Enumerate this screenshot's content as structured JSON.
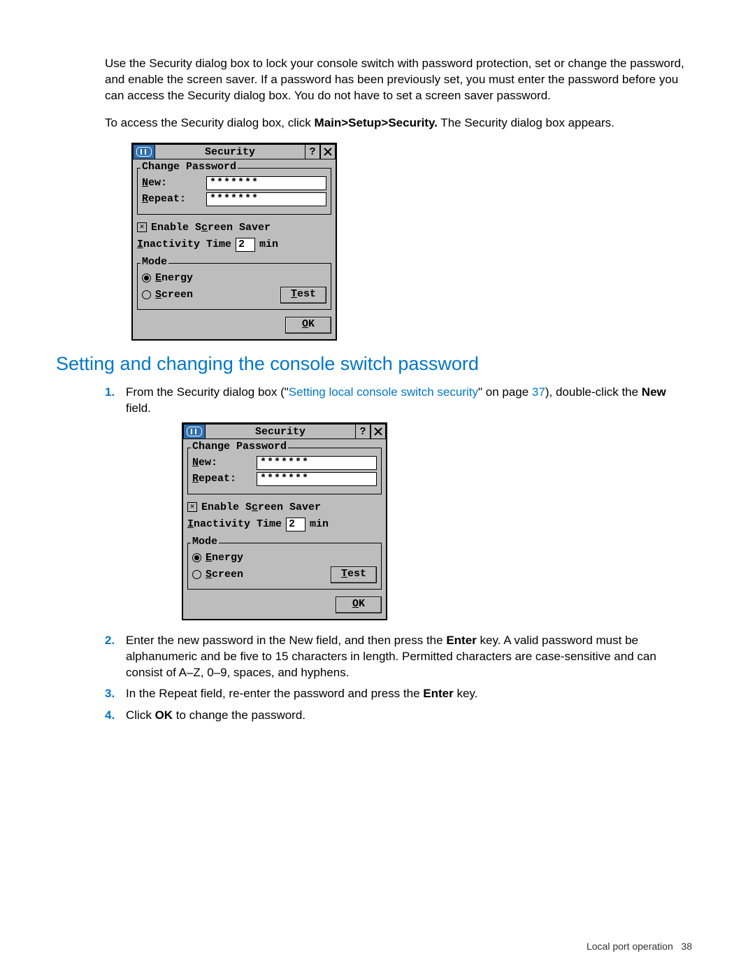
{
  "intro": {
    "p1": "Use the Security dialog box to lock your console switch with password protection, set or change the password, and enable the screen saver. If a password has been previously set, you must enter the password before you can access the Security dialog box. You do not have to set a screen saver password.",
    "p2_pre": "To access the Security dialog box, click ",
    "p2_bold": "Main>Setup>Security.",
    "p2_post": " The Security dialog box appears."
  },
  "heading": "Setting and changing the console switch password",
  "steps": {
    "s1_pre": "From the Security dialog box (\"",
    "s1_link": "Setting local console switch security",
    "s1_mid": "\" on page ",
    "s1_page": "37",
    "s1_post": "), double-click the ",
    "s1_bold": "New",
    "s1_end": " field.",
    "s2_pre": "Enter the new password in the New field, and then press the ",
    "s2_bold": "Enter",
    "s2_post": " key. A valid password must be alphanumeric and be five to 15 characters in length. Permitted characters are case-sensitive and can consist of A–Z, 0–9, spaces, and hyphens.",
    "s3_pre": "In the Repeat field, re-enter the password and press the ",
    "s3_bold": "Enter",
    "s3_post": " key.",
    "s4_pre": "Click ",
    "s4_bold": "OK",
    "s4_post": " to change the password."
  },
  "step_numbers": {
    "n1": "1.",
    "n2": "2.",
    "n3": "3.",
    "n4": "4."
  },
  "dialog": {
    "title": "Security",
    "help_glyph": "?",
    "group_pw": "Change Password",
    "new_prefix": "N",
    "new_rest": "ew:",
    "repeat_prefix": "R",
    "repeat_rest": "epeat:",
    "pw_value": "*******",
    "enable_ss_pre": "Enable S",
    "enable_ss_mn": "c",
    "enable_ss_post": "reen Saver",
    "checkbox_mark": "⊠",
    "inactivity_prefix": "I",
    "inactivity_rest": "nactivity Time",
    "inactivity_value": "2",
    "inactivity_unit": "min",
    "group_mode": "Mode",
    "energy_prefix": "E",
    "energy_rest": "nergy",
    "screen_prefix": "S",
    "screen_rest": "creen",
    "test_prefix": "T",
    "test_rest": "est",
    "ok_prefix": "O",
    "ok_rest": "K"
  },
  "footer": {
    "section": "Local port operation",
    "page": "38"
  }
}
